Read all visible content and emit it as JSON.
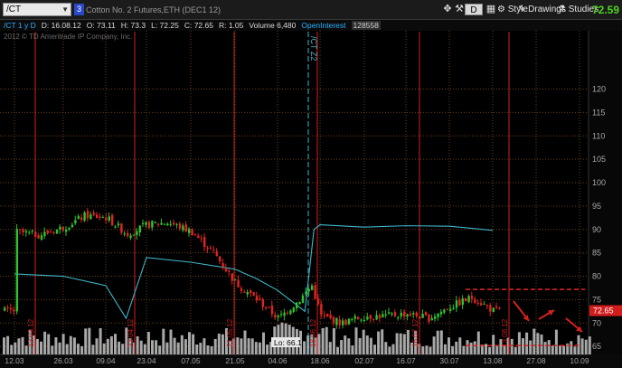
{
  "toolbar": {
    "symbol": "/CT",
    "link_number": "3",
    "description": "Cotton No. 2 Futures,ETH (DEC1 12)",
    "style_label": "Style",
    "drawings_label": "Drawings",
    "studies_label": "Studies",
    "aggregation_label": "D",
    "last_price": "72.59",
    "icons": [
      "crosshair-icon",
      "wrench-icon",
      "layout-icon",
      "style-gear-icon",
      "drawings-pencil-icon",
      "studies-flask-icon",
      "maximize-icon"
    ]
  },
  "quote": {
    "symbol_tag": "/CT 1 y D",
    "date": "D: 16.08.12",
    "open": "O: 73.11",
    "high": "H: 73.3",
    "low": "L: 72.25",
    "close": "C: 72.65",
    "range": "R: 1.05",
    "volume": "Volume  6,480",
    "oi_label": "OpenInterest",
    "oi_value": "128558"
  },
  "copyright": "2012 © TD Ameritrade IP Company, Inc.",
  "price_tag": "72.65",
  "low_marker": "Lo: 66.1",
  "colors": {
    "up": "#2ec22e",
    "down": "#e02424",
    "oi_line": "#3fb6c7",
    "grid": "#6a3f14",
    "event": "#d52020",
    "volume": "#a8a8a8",
    "accent": "#4cd41e"
  },
  "chart_data": {
    "type": "candlestick",
    "price_ylim": [
      63,
      121
    ],
    "price_ticks": [
      120,
      115,
      110,
      105,
      100,
      95,
      90,
      85,
      80,
      75,
      70,
      65
    ],
    "x_ticks": [
      "12.03",
      "26.03",
      "09.04",
      "23.04",
      "07.05",
      "21.05",
      "04.06",
      "18.06",
      "02.07",
      "16.07",
      "30.07",
      "13.08",
      "27.08",
      "10.09"
    ],
    "event_labels": [
      "12.03.12",
      "23.04.12",
      "21.05.12",
      "18.06.12",
      "16.07.12",
      "13.08.12"
    ],
    "vertical_annotation": "/CT Z2",
    "open_interest_approx": [
      [
        "12.03",
        80.5
      ],
      [
        "26.03",
        80.0
      ],
      [
        "09.04",
        78.0
      ],
      [
        "16.04",
        71.0
      ],
      [
        "23.04",
        84.0
      ],
      [
        "07.05",
        83.0
      ],
      [
        "21.05",
        81.5
      ],
      [
        "28.05",
        79.5
      ],
      [
        "04.06",
        77.0
      ],
      [
        "11.06",
        73.5
      ],
      [
        "13.06",
        72.5
      ],
      [
        "16.06",
        90.0
      ],
      [
        "18.06",
        91.0
      ],
      [
        "02.07",
        90.5
      ],
      [
        "16.07",
        90.8
      ],
      [
        "30.07",
        90.7
      ],
      [
        "13.08",
        89.8
      ]
    ],
    "close_path": [
      [
        "12.03",
        89.5
      ],
      [
        "19.03",
        88.8
      ],
      [
        "26.03",
        90.5
      ],
      [
        "02.04",
        93.0
      ],
      [
        "09.04",
        92.5
      ],
      [
        "16.04",
        89.0
      ],
      [
        "23.04",
        91.0
      ],
      [
        "30.04",
        91.5
      ],
      [
        "07.05",
        89.5
      ],
      [
        "14.05",
        85.0
      ],
      [
        "21.05",
        78.5
      ],
      [
        "28.05",
        75.0
      ],
      [
        "04.06",
        71.0
      ],
      [
        "11.06",
        75.0
      ],
      [
        "15.06",
        78.0
      ],
      [
        "18.06",
        71.5
      ],
      [
        "25.06",
        70.0
      ],
      [
        "02.07",
        71.5
      ],
      [
        "09.07",
        71.5
      ],
      [
        "16.07",
        72.0
      ],
      [
        "23.07",
        71.0
      ],
      [
        "30.07",
        73.5
      ],
      [
        "06.08",
        75.5
      ],
      [
        "13.08",
        72.6
      ]
    ]
  }
}
